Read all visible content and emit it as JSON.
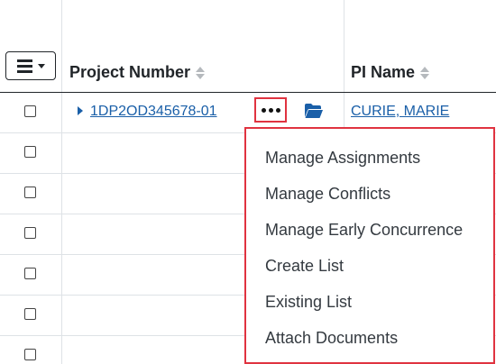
{
  "table": {
    "columns": [
      {
        "label": ""
      },
      {
        "label": "Project Number"
      },
      {
        "label": "PI Name"
      }
    ],
    "rows": [
      {
        "project_number": "1DP2OD345678-01",
        "pi_name": "CURIE, MARIE"
      }
    ]
  },
  "actions_menu": {
    "items": [
      "Manage Assignments",
      "Manage Conflicts",
      "Manage Early Concurrence",
      "Create List",
      "Existing List",
      "Attach Documents"
    ]
  },
  "colors": {
    "link": "#1a5fa8",
    "highlight_border": "#e03340",
    "border": "#dee2e6",
    "header_border": "#212529"
  },
  "icons": [
    "hamburger-icon",
    "caret-down-icon",
    "sort-icon",
    "expand-caret-icon",
    "ellipsis-icon",
    "folder-open-icon"
  ]
}
